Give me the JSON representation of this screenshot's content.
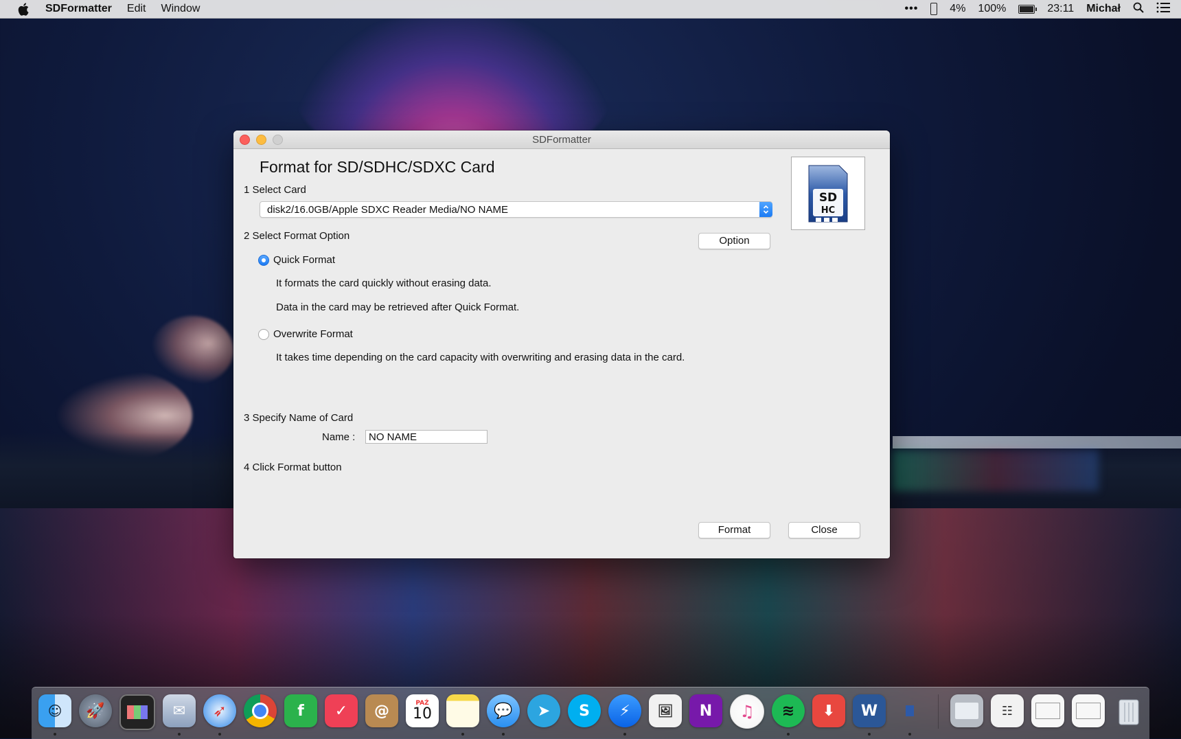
{
  "menubar": {
    "app_name": "SDFormatter",
    "items": [
      "Edit",
      "Window"
    ],
    "status": {
      "cpu": "4%",
      "battery": "100%",
      "time": "23:11",
      "user": "Michał"
    }
  },
  "window": {
    "title": "SDFormatter",
    "heading": "Format for SD/SDHC/SDXC Card",
    "step1": "1 Select Card",
    "card_value": "disk2/16.0GB/Apple SDXC Reader Media/NO NAME",
    "step2": "2 Select Format Option",
    "option_button": "Option",
    "quick_format": "Quick Format",
    "quick_desc1": "It formats the card quickly without erasing data.",
    "quick_desc2": "Data in the card may be retrieved after Quick Format.",
    "overwrite_format": "Overwrite Format",
    "overwrite_desc": "It takes time depending on the card capacity with overwriting and erasing data in the card.",
    "step3": "3 Specify Name of Card",
    "name_label": "Name :",
    "name_value": "NO NAME",
    "step4": "4 Click Format button",
    "format_button": "Format",
    "close_button": "Close",
    "selected_option": "Quick Format"
  },
  "dock": {
    "calendar": {
      "month": "PAŹ",
      "day": "10"
    }
  },
  "colors": {
    "accent": "#1d7bf3",
    "close": "#fc605c",
    "minimize": "#fdbc40"
  }
}
